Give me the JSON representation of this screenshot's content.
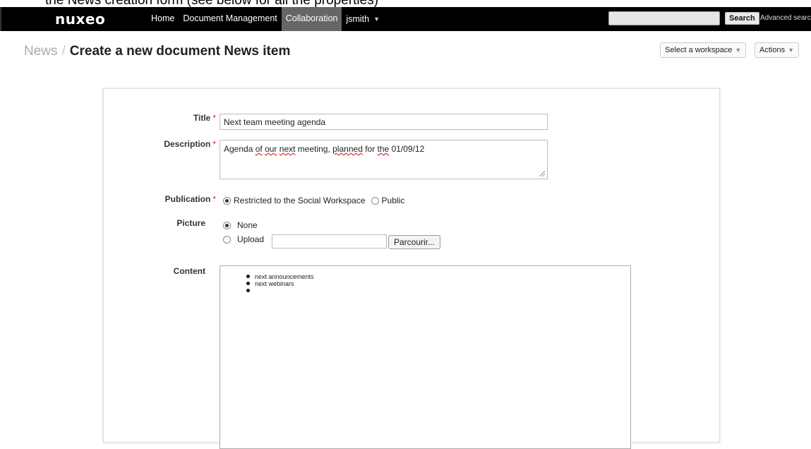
{
  "caption": "the News creation form (see below for all the properties)",
  "topbar": {
    "logo": "nuxeo",
    "nav": [
      "Home",
      "Document Management",
      "Collaboration"
    ],
    "user": "jsmith",
    "search_label": "Search",
    "advanced_search": "Advanced search"
  },
  "page": {
    "breadcrumb_parent": "News",
    "breadcrumb_sep": "/",
    "title": "Create a new document News item",
    "workspace_dropdown": "Select a workspace",
    "actions_dropdown": "Actions"
  },
  "form": {
    "title_label": "Title",
    "title_value": "Next team meeting agenda",
    "description_label": "Description",
    "description_value_parts": [
      "Agenda ",
      "of",
      " ",
      "our",
      " ",
      "next",
      " meeting, ",
      "planned",
      " for ",
      "the",
      " 01/09/12"
    ],
    "publication_label": "Publication",
    "publication_options": [
      "Restricted to the Social Workspace",
      "Public"
    ],
    "publication_selected": "Restricted to the Social Workspace",
    "picture_label": "Picture",
    "picture_options": [
      "None",
      "Upload"
    ],
    "picture_selected": "None",
    "browse_label": "Parcourir...",
    "content_label": "Content",
    "content_items": [
      "next announcements",
      "next webinars",
      ""
    ]
  },
  "colors": {
    "topbar": "#000000",
    "active_nav": "#666666",
    "required": "#dd2222"
  }
}
